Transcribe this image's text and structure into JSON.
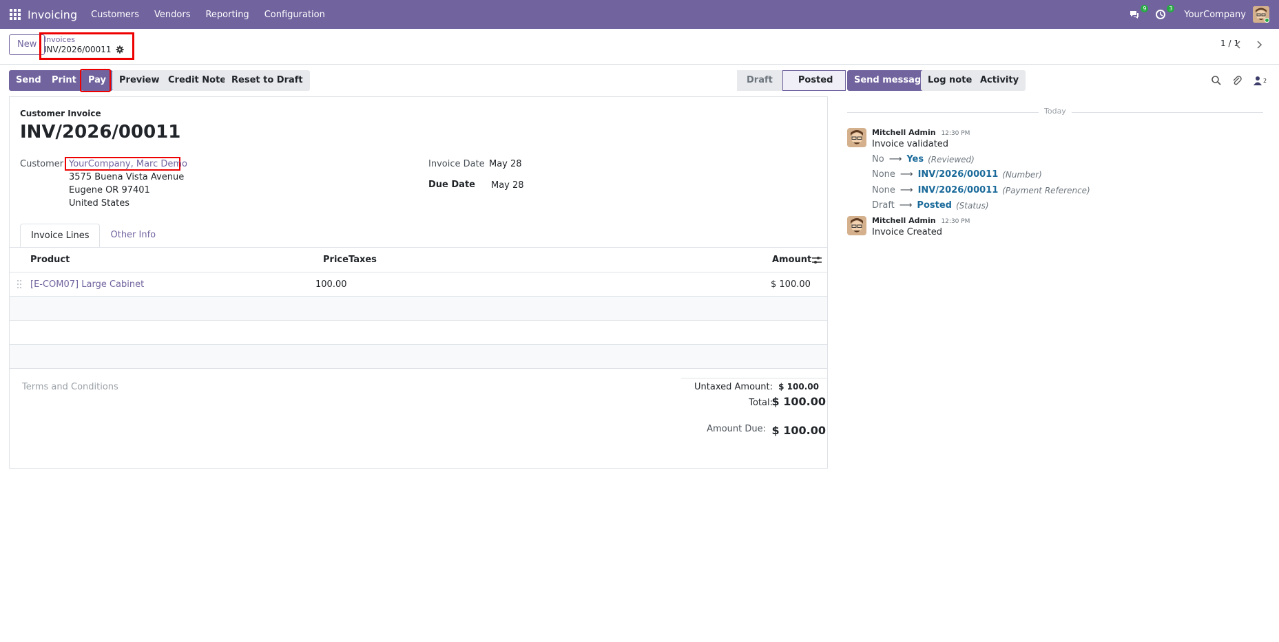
{
  "navbar": {
    "app_name": "Invoicing",
    "menu": [
      "Customers",
      "Vendors",
      "Reporting",
      "Configuration"
    ],
    "messages_count": "9",
    "activities_count": "3",
    "company": "YourCompany"
  },
  "control_panel": {
    "new_label": "New",
    "breadcrumb_parent": "Invoices",
    "breadcrumb_current": "INV/2026/00011",
    "pager": "1 / 1"
  },
  "actions": {
    "send": "Send",
    "print": "Print",
    "pay": "Pay",
    "preview": "Preview",
    "credit_note": "Credit Note",
    "reset_to_draft": "Reset to Draft"
  },
  "statusbar": {
    "draft": "Draft",
    "posted": "Posted"
  },
  "form": {
    "doc_type": "Customer Invoice",
    "doc_name": "INV/2026/00011",
    "customer_label": "Customer",
    "customer_name": "YourCompany, Marc Demo",
    "address_line1": "3575 Buena Vista Avenue",
    "address_line2": "Eugene OR 97401",
    "address_line3": "United States",
    "invoice_date_label": "Invoice Date",
    "invoice_date": "May 28",
    "due_date_label": "Due Date",
    "due_date": "May 28",
    "tabs": [
      "Invoice Lines",
      "Other Info"
    ],
    "columns": {
      "product": "Product",
      "price": "Price",
      "taxes": "Taxes",
      "amount": "Amount"
    },
    "lines": [
      {
        "product": "[E-COM07] Large Cabinet",
        "price": "100.00",
        "taxes": "",
        "amount": "$ 100.00"
      }
    ],
    "terms_placeholder": "Terms and Conditions",
    "untaxed_label": "Untaxed Amount:",
    "untaxed_value": "$ 100.00",
    "total_label": "Total:",
    "total_value": "$ 100.00",
    "amount_due_label": "Amount Due:",
    "amount_due_value": "$ 100.00"
  },
  "chatter": {
    "send_message": "Send message",
    "log_note": "Log note",
    "activity": "Activity",
    "followers_count": "2",
    "day_label": "Today",
    "messages": [
      {
        "author": "Mitchell Admin",
        "time": "12:30 PM",
        "body": "Invoice validated",
        "tracking": [
          {
            "old": "No",
            "new": "Yes",
            "field": "(Reviewed)"
          },
          {
            "old": "None",
            "new": "INV/2026/00011",
            "field": "(Number)"
          },
          {
            "old": "None",
            "new": "INV/2026/00011",
            "field": "(Payment Reference)"
          },
          {
            "old": "Draft",
            "new": "Posted",
            "field": "(Status)"
          }
        ]
      },
      {
        "author": "Mitchell Admin",
        "time": "12:30 PM",
        "body": "Invoice Created",
        "tracking": []
      }
    ]
  },
  "colors": {
    "brand": "#71639e",
    "badge": "#28a745",
    "highlight": "#e00000",
    "link": "#1a6a9a"
  }
}
